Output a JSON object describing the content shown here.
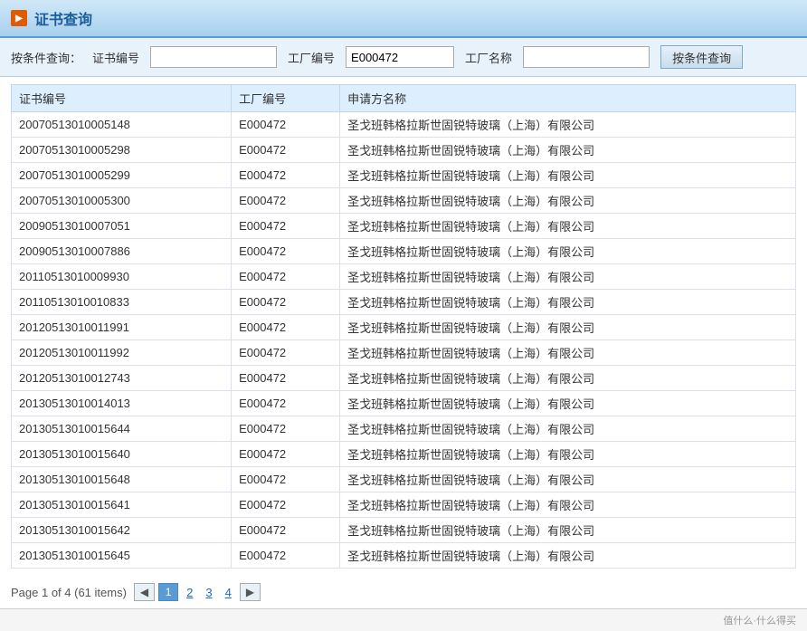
{
  "header": {
    "icon_label": "▶",
    "title": "证书查询"
  },
  "search": {
    "section_label": "按条件查询：",
    "cert_no_label": "证书编号",
    "cert_no_value": "",
    "factory_no_label": "工厂编号",
    "factory_no_value": "E000472",
    "factory_name_label": "工厂名称",
    "factory_name_value": "",
    "button_label": "按条件查询"
  },
  "table": {
    "columns": [
      "证书编号",
      "工厂编号",
      "申请方名称"
    ],
    "rows": [
      {
        "cert_no": "20070513010005148",
        "factory_no": "E000472",
        "applicant": "圣戈班韩格拉斯世固锐特玻璃（上海）有限公司"
      },
      {
        "cert_no": "20070513010005298",
        "factory_no": "E000472",
        "applicant": "圣戈班韩格拉斯世固锐特玻璃（上海）有限公司"
      },
      {
        "cert_no": "20070513010005299",
        "factory_no": "E000472",
        "applicant": "圣戈班韩格拉斯世固锐特玻璃（上海）有限公司"
      },
      {
        "cert_no": "20070513010005300",
        "factory_no": "E000472",
        "applicant": "圣戈班韩格拉斯世固锐特玻璃（上海）有限公司"
      },
      {
        "cert_no": "20090513010007051",
        "factory_no": "E000472",
        "applicant": "圣戈班韩格拉斯世固锐特玻璃（上海）有限公司"
      },
      {
        "cert_no": "20090513010007886",
        "factory_no": "E000472",
        "applicant": "圣戈班韩格拉斯世固锐特玻璃（上海）有限公司"
      },
      {
        "cert_no": "20110513010009930",
        "factory_no": "E000472",
        "applicant": "圣戈班韩格拉斯世固锐特玻璃（上海）有限公司"
      },
      {
        "cert_no": "20110513010010833",
        "factory_no": "E000472",
        "applicant": "圣戈班韩格拉斯世固锐特玻璃（上海）有限公司"
      },
      {
        "cert_no": "20120513010011991",
        "factory_no": "E000472",
        "applicant": "圣戈班韩格拉斯世固锐特玻璃（上海）有限公司"
      },
      {
        "cert_no": "20120513010011992",
        "factory_no": "E000472",
        "applicant": "圣戈班韩格拉斯世固锐特玻璃（上海）有限公司"
      },
      {
        "cert_no": "20120513010012743",
        "factory_no": "E000472",
        "applicant": "圣戈班韩格拉斯世固锐特玻璃（上海）有限公司"
      },
      {
        "cert_no": "20130513010014013",
        "factory_no": "E000472",
        "applicant": "圣戈班韩格拉斯世固锐特玻璃（上海）有限公司"
      },
      {
        "cert_no": "20130513010015644",
        "factory_no": "E000472",
        "applicant": "圣戈班韩格拉斯世固锐特玻璃（上海）有限公司"
      },
      {
        "cert_no": "20130513010015640",
        "factory_no": "E000472",
        "applicant": "圣戈班韩格拉斯世固锐特玻璃（上海）有限公司"
      },
      {
        "cert_no": "20130513010015648",
        "factory_no": "E000472",
        "applicant": "圣戈班韩格拉斯世固锐特玻璃（上海）有限公司"
      },
      {
        "cert_no": "20130513010015641",
        "factory_no": "E000472",
        "applicant": "圣戈班韩格拉斯世固锐特玻璃（上海）有限公司"
      },
      {
        "cert_no": "20130513010015642",
        "factory_no": "E000472",
        "applicant": "圣戈班韩格拉斯世固锐特玻璃（上海）有限公司"
      },
      {
        "cert_no": "20130513010015645",
        "factory_no": "E000472",
        "applicant": "圣戈班韩格拉斯世固锐特玻璃（上海）有限公司"
      }
    ]
  },
  "pagination": {
    "info": "Page 1 of 4 (61 items)",
    "prev_label": "◀",
    "next_label": "▶",
    "current_page": 1,
    "total_pages": 4,
    "pages": [
      "1",
      "2",
      "3",
      "4"
    ]
  },
  "footer": {
    "watermark": "值什么·什么得买"
  }
}
